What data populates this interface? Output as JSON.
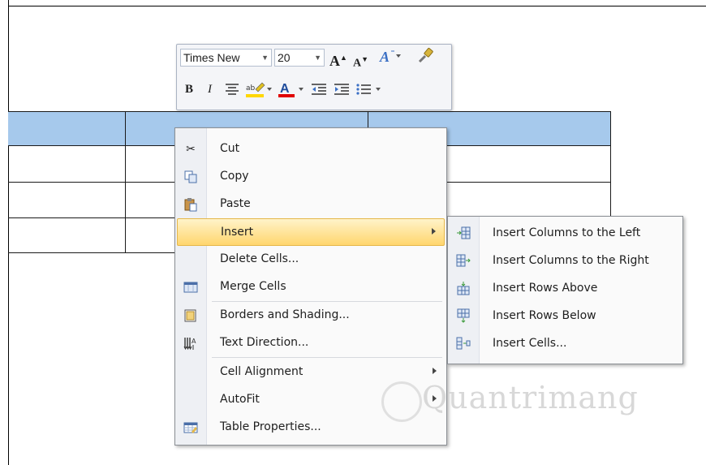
{
  "mini_toolbar": {
    "font_name": "Times New",
    "font_size": "20",
    "grow_font": "A",
    "shrink_font": "A",
    "bold": "B",
    "italic": "I",
    "font_color": "A"
  },
  "context_menu": {
    "items": [
      {
        "label": "Cut",
        "icon": "scissors-icon"
      },
      {
        "label": "Copy",
        "icon": "copy-icon"
      },
      {
        "label": "Paste",
        "icon": "paste-icon"
      },
      {
        "label": "Insert",
        "icon": "",
        "submenu": true,
        "highlighted": true
      },
      {
        "label": "Delete Cells...",
        "icon": ""
      },
      {
        "label": "Merge Cells",
        "icon": "merge-cells-icon"
      },
      {
        "label": "Borders and Shading...",
        "icon": "borders-icon"
      },
      {
        "label": "Text Direction...",
        "icon": "text-direction-icon"
      },
      {
        "label": "Cell Alignment",
        "icon": "",
        "submenu": true
      },
      {
        "label": "AutoFit",
        "icon": "",
        "submenu": true
      },
      {
        "label": "Table Properties...",
        "icon": "table-properties-icon"
      }
    ]
  },
  "insert_submenu": {
    "items": [
      {
        "label": "Insert Columns to the Left",
        "icon": "insert-columns-left-icon"
      },
      {
        "label": "Insert Columns to the Right",
        "icon": "insert-columns-right-icon"
      },
      {
        "label": "Insert Rows Above",
        "icon": "insert-rows-above-icon"
      },
      {
        "label": "Insert Rows Below",
        "icon": "insert-rows-below-icon"
      },
      {
        "label": "Insert Cells...",
        "icon": "insert-cells-icon"
      }
    ]
  },
  "watermark": "Quantrimang",
  "colors": {
    "header_row": "#a6c9ec",
    "menu_highlight": "#ffd66e",
    "font_color_bar": "#e00000"
  }
}
